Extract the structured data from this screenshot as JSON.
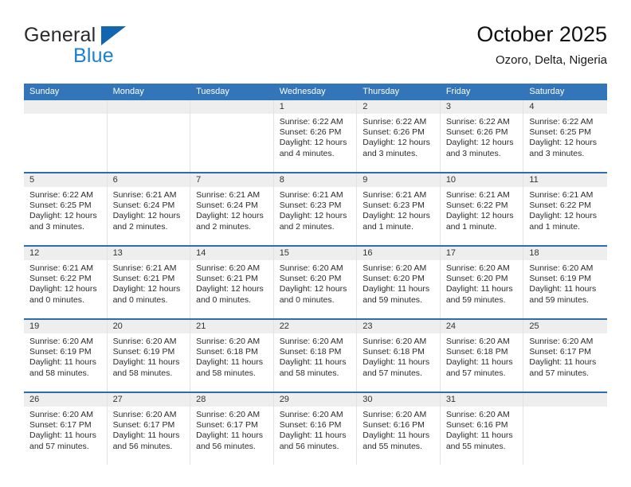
{
  "brand": {
    "name_part1": "General",
    "name_part2": "Blue",
    "triangle_icon": "brand-triangle-icon"
  },
  "header": {
    "title": "October 2025",
    "subtitle": "Ozoro, Delta, Nigeria"
  },
  "colors": {
    "header_blue": "#3275b9",
    "row_divider_blue": "#2e6cab",
    "date_strip_grey": "#eeeeee",
    "brand_blue": "#1b7fd4",
    "brand_dark": "#2b2b2b"
  },
  "weekdays": [
    "Sunday",
    "Monday",
    "Tuesday",
    "Wednesday",
    "Thursday",
    "Friday",
    "Saturday"
  ],
  "labels": {
    "sunrise": "Sunrise:",
    "sunset": "Sunset:",
    "daylight": "Daylight:"
  },
  "weeks": [
    [
      {
        "day": "",
        "empty": true
      },
      {
        "day": "",
        "empty": true
      },
      {
        "day": "",
        "empty": true
      },
      {
        "day": "1",
        "sunrise": "Sunrise: 6:22 AM",
        "sunset": "Sunset: 6:26 PM",
        "daylight_line1": "Daylight: 12 hours",
        "daylight_line2": "and 4 minutes."
      },
      {
        "day": "2",
        "sunrise": "Sunrise: 6:22 AM",
        "sunset": "Sunset: 6:26 PM",
        "daylight_line1": "Daylight: 12 hours",
        "daylight_line2": "and 3 minutes."
      },
      {
        "day": "3",
        "sunrise": "Sunrise: 6:22 AM",
        "sunset": "Sunset: 6:26 PM",
        "daylight_line1": "Daylight: 12 hours",
        "daylight_line2": "and 3 minutes."
      },
      {
        "day": "4",
        "sunrise": "Sunrise: 6:22 AM",
        "sunset": "Sunset: 6:25 PM",
        "daylight_line1": "Daylight: 12 hours",
        "daylight_line2": "and 3 minutes."
      }
    ],
    [
      {
        "day": "5",
        "sunrise": "Sunrise: 6:22 AM",
        "sunset": "Sunset: 6:25 PM",
        "daylight_line1": "Daylight: 12 hours",
        "daylight_line2": "and 3 minutes."
      },
      {
        "day": "6",
        "sunrise": "Sunrise: 6:21 AM",
        "sunset": "Sunset: 6:24 PM",
        "daylight_line1": "Daylight: 12 hours",
        "daylight_line2": "and 2 minutes."
      },
      {
        "day": "7",
        "sunrise": "Sunrise: 6:21 AM",
        "sunset": "Sunset: 6:24 PM",
        "daylight_line1": "Daylight: 12 hours",
        "daylight_line2": "and 2 minutes."
      },
      {
        "day": "8",
        "sunrise": "Sunrise: 6:21 AM",
        "sunset": "Sunset: 6:23 PM",
        "daylight_line1": "Daylight: 12 hours",
        "daylight_line2": "and 2 minutes."
      },
      {
        "day": "9",
        "sunrise": "Sunrise: 6:21 AM",
        "sunset": "Sunset: 6:23 PM",
        "daylight_line1": "Daylight: 12 hours",
        "daylight_line2": "and 1 minute."
      },
      {
        "day": "10",
        "sunrise": "Sunrise: 6:21 AM",
        "sunset": "Sunset: 6:22 PM",
        "daylight_line1": "Daylight: 12 hours",
        "daylight_line2": "and 1 minute."
      },
      {
        "day": "11",
        "sunrise": "Sunrise: 6:21 AM",
        "sunset": "Sunset: 6:22 PM",
        "daylight_line1": "Daylight: 12 hours",
        "daylight_line2": "and 1 minute."
      }
    ],
    [
      {
        "day": "12",
        "sunrise": "Sunrise: 6:21 AM",
        "sunset": "Sunset: 6:22 PM",
        "daylight_line1": "Daylight: 12 hours",
        "daylight_line2": "and 0 minutes."
      },
      {
        "day": "13",
        "sunrise": "Sunrise: 6:21 AM",
        "sunset": "Sunset: 6:21 PM",
        "daylight_line1": "Daylight: 12 hours",
        "daylight_line2": "and 0 minutes."
      },
      {
        "day": "14",
        "sunrise": "Sunrise: 6:20 AM",
        "sunset": "Sunset: 6:21 PM",
        "daylight_line1": "Daylight: 12 hours",
        "daylight_line2": "and 0 minutes."
      },
      {
        "day": "15",
        "sunrise": "Sunrise: 6:20 AM",
        "sunset": "Sunset: 6:20 PM",
        "daylight_line1": "Daylight: 12 hours",
        "daylight_line2": "and 0 minutes."
      },
      {
        "day": "16",
        "sunrise": "Sunrise: 6:20 AM",
        "sunset": "Sunset: 6:20 PM",
        "daylight_line1": "Daylight: 11 hours",
        "daylight_line2": "and 59 minutes."
      },
      {
        "day": "17",
        "sunrise": "Sunrise: 6:20 AM",
        "sunset": "Sunset: 6:20 PM",
        "daylight_line1": "Daylight: 11 hours",
        "daylight_line2": "and 59 minutes."
      },
      {
        "day": "18",
        "sunrise": "Sunrise: 6:20 AM",
        "sunset": "Sunset: 6:19 PM",
        "daylight_line1": "Daylight: 11 hours",
        "daylight_line2": "and 59 minutes."
      }
    ],
    [
      {
        "day": "19",
        "sunrise": "Sunrise: 6:20 AM",
        "sunset": "Sunset: 6:19 PM",
        "daylight_line1": "Daylight: 11 hours",
        "daylight_line2": "and 58 minutes."
      },
      {
        "day": "20",
        "sunrise": "Sunrise: 6:20 AM",
        "sunset": "Sunset: 6:19 PM",
        "daylight_line1": "Daylight: 11 hours",
        "daylight_line2": "and 58 minutes."
      },
      {
        "day": "21",
        "sunrise": "Sunrise: 6:20 AM",
        "sunset": "Sunset: 6:18 PM",
        "daylight_line1": "Daylight: 11 hours",
        "daylight_line2": "and 58 minutes."
      },
      {
        "day": "22",
        "sunrise": "Sunrise: 6:20 AM",
        "sunset": "Sunset: 6:18 PM",
        "daylight_line1": "Daylight: 11 hours",
        "daylight_line2": "and 58 minutes."
      },
      {
        "day": "23",
        "sunrise": "Sunrise: 6:20 AM",
        "sunset": "Sunset: 6:18 PM",
        "daylight_line1": "Daylight: 11 hours",
        "daylight_line2": "and 57 minutes."
      },
      {
        "day": "24",
        "sunrise": "Sunrise: 6:20 AM",
        "sunset": "Sunset: 6:18 PM",
        "daylight_line1": "Daylight: 11 hours",
        "daylight_line2": "and 57 minutes."
      },
      {
        "day": "25",
        "sunrise": "Sunrise: 6:20 AM",
        "sunset": "Sunset: 6:17 PM",
        "daylight_line1": "Daylight: 11 hours",
        "daylight_line2": "and 57 minutes."
      }
    ],
    [
      {
        "day": "26",
        "sunrise": "Sunrise: 6:20 AM",
        "sunset": "Sunset: 6:17 PM",
        "daylight_line1": "Daylight: 11 hours",
        "daylight_line2": "and 57 minutes."
      },
      {
        "day": "27",
        "sunrise": "Sunrise: 6:20 AM",
        "sunset": "Sunset: 6:17 PM",
        "daylight_line1": "Daylight: 11 hours",
        "daylight_line2": "and 56 minutes."
      },
      {
        "day": "28",
        "sunrise": "Sunrise: 6:20 AM",
        "sunset": "Sunset: 6:17 PM",
        "daylight_line1": "Daylight: 11 hours",
        "daylight_line2": "and 56 minutes."
      },
      {
        "day": "29",
        "sunrise": "Sunrise: 6:20 AM",
        "sunset": "Sunset: 6:16 PM",
        "daylight_line1": "Daylight: 11 hours",
        "daylight_line2": "and 56 minutes."
      },
      {
        "day": "30",
        "sunrise": "Sunrise: 6:20 AM",
        "sunset": "Sunset: 6:16 PM",
        "daylight_line1": "Daylight: 11 hours",
        "daylight_line2": "and 55 minutes."
      },
      {
        "day": "31",
        "sunrise": "Sunrise: 6:20 AM",
        "sunset": "Sunset: 6:16 PM",
        "daylight_line1": "Daylight: 11 hours",
        "daylight_line2": "and 55 minutes."
      },
      {
        "day": "",
        "empty": true
      }
    ]
  ]
}
